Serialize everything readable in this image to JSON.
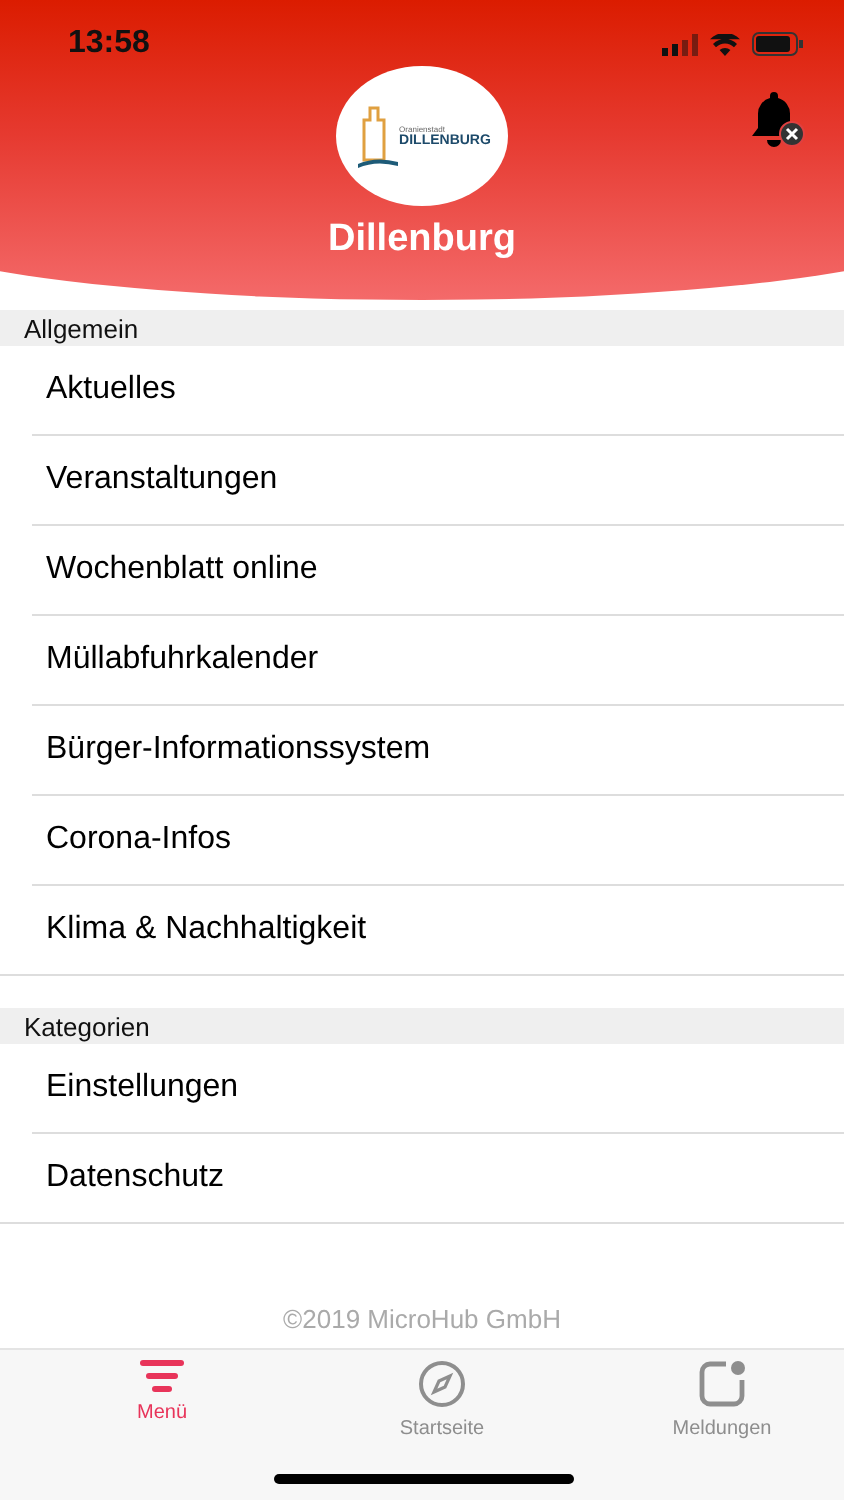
{
  "status_bar": {
    "time": "13:58"
  },
  "header": {
    "logo": {
      "small_text": "Oranienstadt",
      "big_text": "DILLENBURG"
    },
    "title": "Dillenburg"
  },
  "sections": [
    {
      "title": "Allgemein",
      "items": [
        "Aktuelles",
        "Veranstaltungen",
        "Wochenblatt online",
        "Müllabfuhrkalender",
        "Bürger-Informationssystem",
        "Corona-Infos",
        "Klima & Nachhaltigkeit"
      ]
    },
    {
      "title": "Kategorien",
      "items": [
        "Einstellungen",
        "Datenschutz"
      ]
    }
  ],
  "footer": "©2019 MicroHub GmbH",
  "tab_bar": [
    {
      "label": "Menü",
      "kind": "menu",
      "selected": true
    },
    {
      "label": "Startseite",
      "kind": "compass",
      "selected": false
    },
    {
      "label": "Meldungen",
      "kind": "messages",
      "selected": false
    }
  ]
}
